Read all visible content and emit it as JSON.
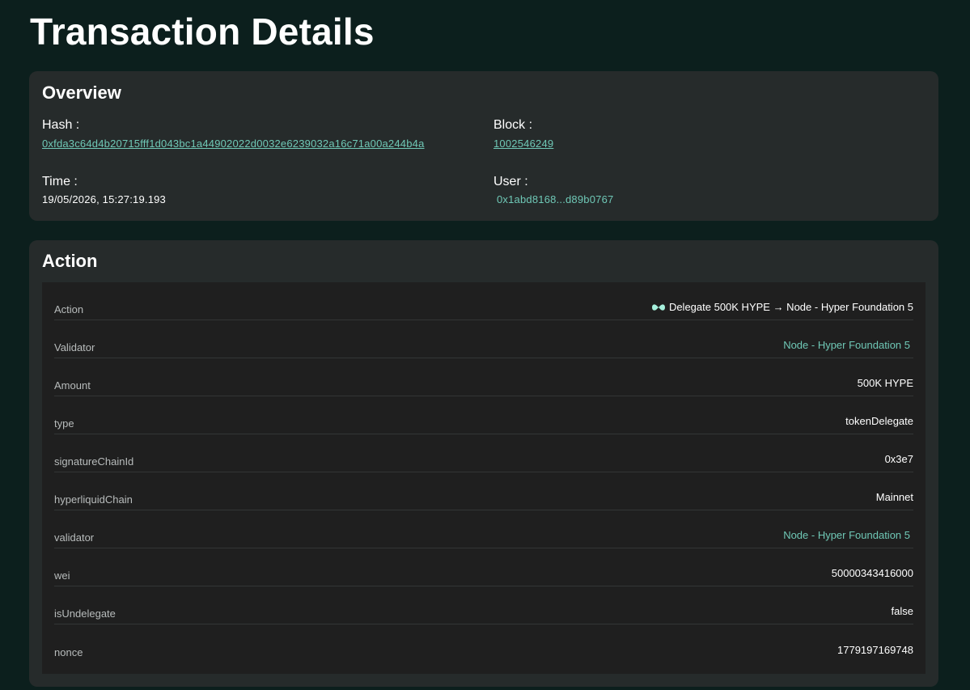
{
  "page": {
    "title": "Transaction Details"
  },
  "overview": {
    "title": "Overview",
    "hash_label": "Hash :",
    "hash_value": "0xfda3c64d4b20715fff1d043bc1a44902022d0032e6239032a16c71a00a244b4a",
    "block_label": "Block :",
    "block_value": "1002546249",
    "time_label": "Time :",
    "time_value": "19/05/2026, 15:27:19.193",
    "user_label": "User :",
    "user_value": "0x1abd8168...d89b0767"
  },
  "action": {
    "title": "Action",
    "rows": [
      {
        "key": "Action",
        "value": "Delegate 500K HYPE → Node - Hyper Foundation 5",
        "icon": "hype-logo-icon"
      },
      {
        "key": "Validator",
        "value": "Node - Hyper Foundation 5",
        "link": true
      },
      {
        "key": "Amount",
        "value": "500K HYPE"
      },
      {
        "key": "type",
        "value": "tokenDelegate"
      },
      {
        "key": "signatureChainId",
        "value": "0x3e7"
      },
      {
        "key": "hyperliquidChain",
        "value": "Mainnet"
      },
      {
        "key": "validator",
        "value": "Node - Hyper Foundation 5",
        "link": true
      },
      {
        "key": "wei",
        "value": "50000343416000"
      },
      {
        "key": "isUndelegate",
        "value": "false"
      },
      {
        "key": "nonce",
        "value": "1779197169748"
      }
    ]
  },
  "colors": {
    "background": "#0c1f1d",
    "card": "#262b2b",
    "table": "#1f1f1f",
    "link": "#6fc8b6"
  }
}
